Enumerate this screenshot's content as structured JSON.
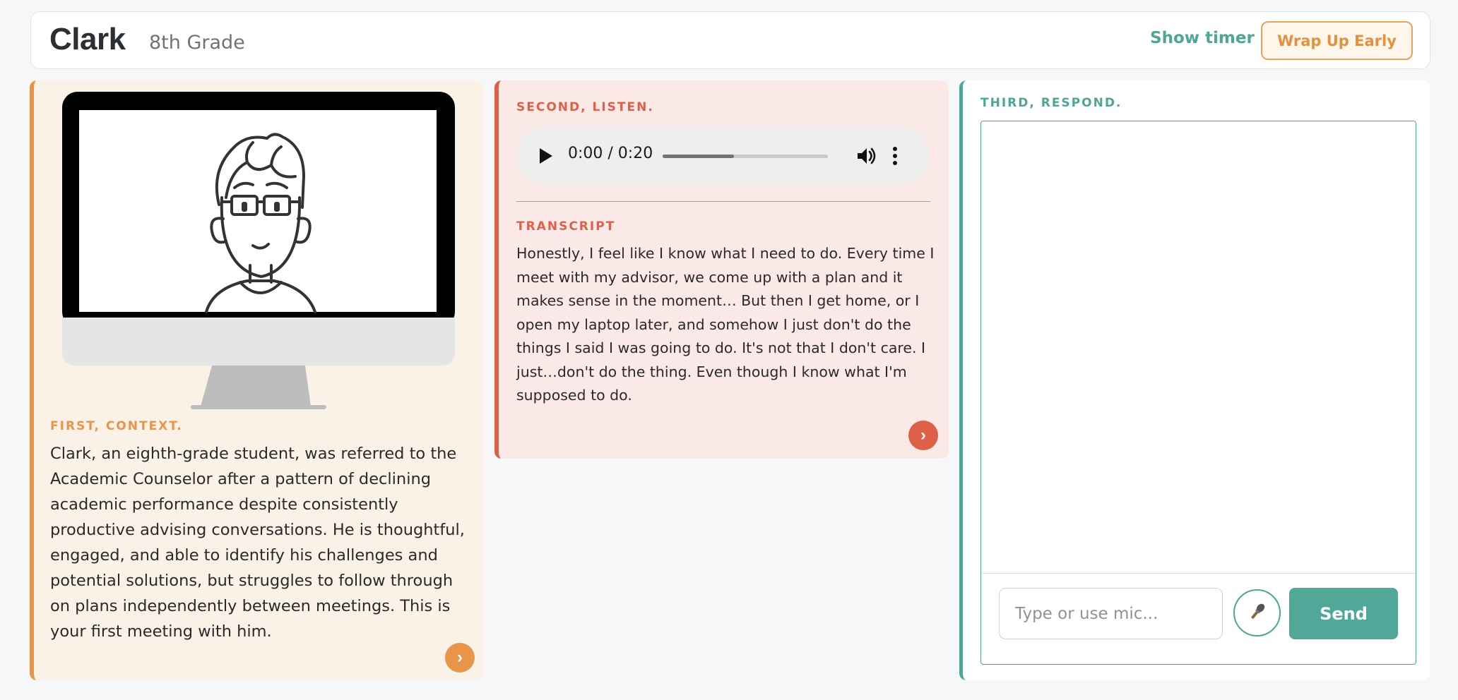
{
  "header": {
    "student_name": "Clark",
    "grade": "8th Grade",
    "show_timer_label": "Show timer",
    "wrap_up_label": "Wrap Up Early"
  },
  "context": {
    "label": "FIRST, CONTEXT.",
    "text": "Clark, an eighth-grade student, was referred to the Academic Counselor after a pattern of declining academic performance despite consistently productive advising conversations. He is thoughtful, engaged, and able to identify his challenges and potential solutions, but struggles to follow through on plans independently between meetings. This is your first meeting with him.",
    "next_label": "›"
  },
  "listen": {
    "label": "SECOND, LISTEN.",
    "audio": {
      "time": "0:00 / 0:20",
      "progress": 0.43
    },
    "transcript_label": "TRANSCRIPT",
    "transcript": "Honestly, I feel like I know what I need to do. Every time I meet with my advisor, we come up with a plan and it makes sense in the moment… But then I get home, or I open my laptop later, and somehow I just don't do the things I said I was going to do. It's not that I don't care. I just…don't do the thing. Even though I know what I'm supposed to do.",
    "next_label": "›"
  },
  "respond": {
    "label": "THIRD, RESPOND.",
    "input_placeholder": "Type or use mic...",
    "send_label": "Send"
  },
  "icons": {
    "play": "play-icon",
    "volume": "volume-icon",
    "more": "more-vertical-icon",
    "mic": "microphone-icon"
  },
  "colors": {
    "context_accent": "#e8954a",
    "listen_accent": "#de6048",
    "respond_accent": "#4fa696"
  }
}
